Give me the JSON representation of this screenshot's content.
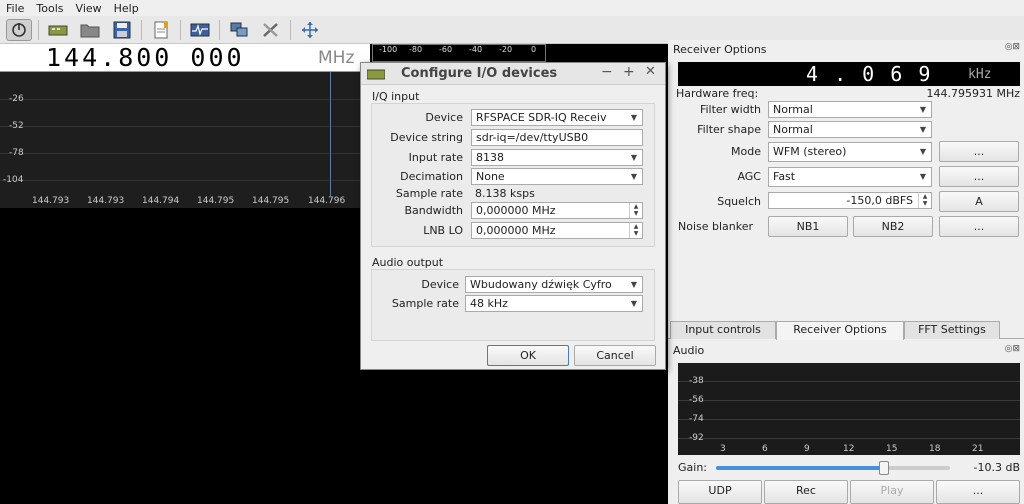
{
  "menu": [
    "File",
    "Tools",
    "View",
    "Help"
  ],
  "toolbar": [
    "power-icon",
    "device-icon",
    "open-icon",
    "save-icon",
    "bookmark-icon",
    "fft-icon",
    "network-icon",
    "tools-icon",
    "move-icon"
  ],
  "frequency": {
    "digits": "144.800 000",
    "unit": "MHz"
  },
  "db_scale": [
    "-100",
    "-80",
    "-60",
    "-40",
    "-20",
    "0"
  ],
  "fft": {
    "db_labels": [
      "-26",
      "-52",
      "-78",
      "-104"
    ],
    "freq_labels": [
      "144.793",
      "144.793",
      "144.794",
      "144.795",
      "144.795",
      "144.796"
    ]
  },
  "receiver": {
    "title": "Receiver Options",
    "offset_digits": "4 . 0 6 9",
    "offset_unit": "kHz",
    "hw_freq_label": "Hardware freq:",
    "hw_freq_value": "144.795931 MHz",
    "filter_width_label": "Filter width",
    "filter_width": "Normal",
    "filter_shape_label": "Filter shape",
    "filter_shape": "Normal",
    "mode_label": "Mode",
    "mode": "WFM (stereo)",
    "agc_label": "AGC",
    "agc": "Fast",
    "squelch_label": "Squelch",
    "squelch": "-150,0 dBFS",
    "squelch_btn": "A",
    "noise_label": "Noise blanker",
    "nb1": "NB1",
    "nb2": "NB2",
    "more": "..."
  },
  "tabs": [
    "Input controls",
    "Receiver Options",
    "FFT Settings"
  ],
  "audio": {
    "title": "Audio",
    "db_labels": [
      "-38",
      "-56",
      "-74",
      "-92"
    ],
    "freq_labels": [
      "3",
      "6",
      "9",
      "12",
      "15",
      "18",
      "21"
    ],
    "gain_label": "Gain:",
    "gain_value": "-10.3 dB",
    "gain_level": 0.72,
    "udp": "UDP",
    "rec": "Rec",
    "play": "Play",
    "more": "..."
  },
  "dialog": {
    "title": "Configure I/O devices",
    "iq_group": "I/Q input",
    "device_label": "Device",
    "device": "RFSPACE SDR-IQ Receiv",
    "devstr_label": "Device string",
    "devstr": "sdr-iq=/dev/ttyUSB0",
    "rate_label": "Input rate",
    "rate": "8138",
    "dec_label": "Decimation",
    "dec": "None",
    "sr_label": "Sample rate",
    "sr": "8.138 ksps",
    "bw_label": "Bandwidth",
    "bw": "0,000000 MHz",
    "lnb_label": "LNB LO",
    "lnb": "0,000000 MHz",
    "audio_group": "Audio output",
    "adev_label": "Device",
    "adev": "Wbudowany dźwięk Cyfro",
    "asr_label": "Sample rate",
    "asr": "48 kHz",
    "ok": "OK",
    "cancel": "Cancel"
  }
}
